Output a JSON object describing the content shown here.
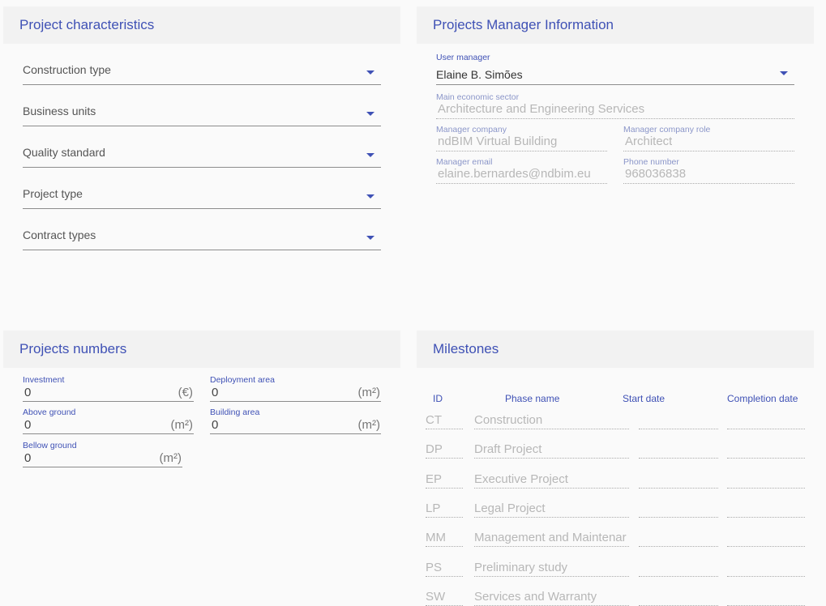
{
  "project_characteristics": {
    "title": "Project characteristics",
    "fields": [
      {
        "label": "Construction type"
      },
      {
        "label": "Business units"
      },
      {
        "label": "Quality standard"
      },
      {
        "label": "Project type"
      },
      {
        "label": "Contract types"
      }
    ]
  },
  "manager_info": {
    "title": "Projects Manager Information",
    "user_manager": {
      "label": "User manager",
      "value": "Elaine B. Simões"
    },
    "economic_sector": {
      "label": "Main economic sector",
      "value": "Architecture and Engineering Services"
    },
    "company": {
      "label": "Manager company",
      "value": "ndBIM Virtual Building"
    },
    "company_role": {
      "label": "Manager company role",
      "value": "Architect"
    },
    "email": {
      "label": "Manager email",
      "value": "elaine.bernardes@ndbim.eu"
    },
    "phone": {
      "label": "Phone number",
      "value": "968036838"
    }
  },
  "project_numbers": {
    "title": "Projects numbers",
    "investment": {
      "label": "Investment",
      "value": "0",
      "unit": "(€)"
    },
    "deployment_area": {
      "label": "Deployment area",
      "value": "0",
      "unit": "(m²)"
    },
    "above_ground": {
      "label": "Above ground",
      "value": "0",
      "unit": "(m²)"
    },
    "building_area": {
      "label": "Building area",
      "value": "0",
      "unit": "(m²)"
    },
    "bellow_ground": {
      "label": "Bellow ground",
      "value": "0",
      "unit": "(m²)"
    }
  },
  "milestones": {
    "title": "Milestones",
    "columns": {
      "id": "ID",
      "phase": "Phase name",
      "start": "Start date",
      "completion": "Completion date"
    },
    "rows": [
      {
        "id": "CT",
        "phase": "Construction"
      },
      {
        "id": "DP",
        "phase": "Draft Project"
      },
      {
        "id": "EP",
        "phase": "Executive Project"
      },
      {
        "id": "LP",
        "phase": "Legal Project"
      },
      {
        "id": "MM",
        "phase": "Management and Maintenar"
      },
      {
        "id": "PS",
        "phase": "Preliminary study"
      },
      {
        "id": "SW",
        "phase": "Services and Warranty"
      }
    ]
  },
  "colors": {
    "accent": "#3f51b5",
    "header_bg": "#f2f2f2",
    "page_bg": "#fafafa"
  }
}
